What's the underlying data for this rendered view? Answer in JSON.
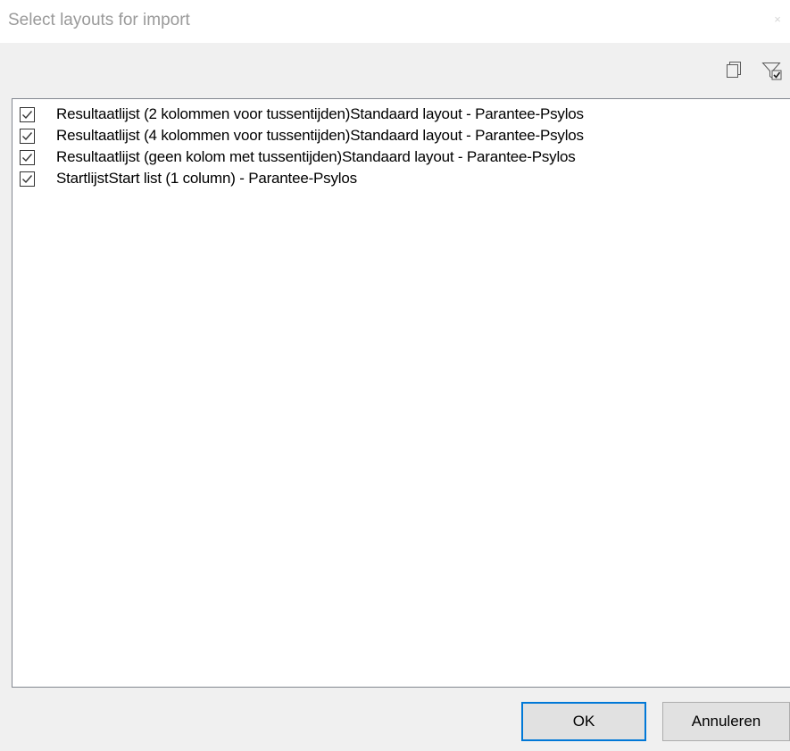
{
  "window": {
    "title": "Select layouts for import",
    "close_glyph": "×"
  },
  "toolbar": {
    "icons": [
      "copy-icon",
      "filter-check-icon"
    ]
  },
  "layouts": [
    {
      "label": "Resultaatlijst (2 kolommen voor tussentijden)Standaard layout - Parantee-Psylos",
      "checked": true
    },
    {
      "label": "Resultaatlijst (4 kolommen voor tussentijden)Standaard layout - Parantee-Psylos",
      "checked": true
    },
    {
      "label": "Resultaatlijst (geen kolom met tussentijden)Standaard layout - Parantee-Psylos",
      "checked": true
    },
    {
      "label": "StartlijstStart list (1 column) - Parantee-Psylos",
      "checked": true
    }
  ],
  "buttons": {
    "ok_label": "OK",
    "cancel_label": "Annuleren"
  },
  "colors": {
    "accent": "#0078d7",
    "background": "#f0f0f0"
  }
}
